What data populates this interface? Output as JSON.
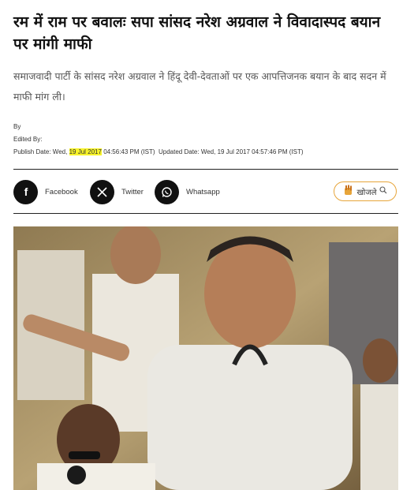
{
  "article": {
    "headline": "रम में राम पर बवालः सपा सांसद नरेश अग्रवाल ने विवादास्पद बयान पर मांगी माफी",
    "summary": "समाजवादी पार्टी के सांसद नरेश अग्रवाल ने हिंदू देवी-देवताओं पर एक आपत्तिजनक बयान के बाद सदन में माफी मांग ली।",
    "by_label": "By",
    "edited_by_label": "Edited By:",
    "publish_prefix": "Publish Date: Wed,",
    "publish_date_highlight": "19 Jul 2017",
    "publish_time": "04:56:43 PM (IST)",
    "updated": "Updated Date: Wed, 19 Jul 2017 04:57:46 PM (IST)"
  },
  "share": {
    "facebook_label": "Facebook",
    "twitter_label": "Twitter",
    "whatsapp_label": "Whatsapp",
    "search_label": "खोजले",
    "icons": {
      "facebook": "facebook-icon",
      "twitter": "x-icon",
      "whatsapp": "whatsapp-icon",
      "search": "search-icon",
      "brand": "hand-logo-icon"
    }
  },
  "colors": {
    "highlight": "#f7f32a",
    "search_border": "#e7a53a",
    "share_circle": "#111111"
  }
}
